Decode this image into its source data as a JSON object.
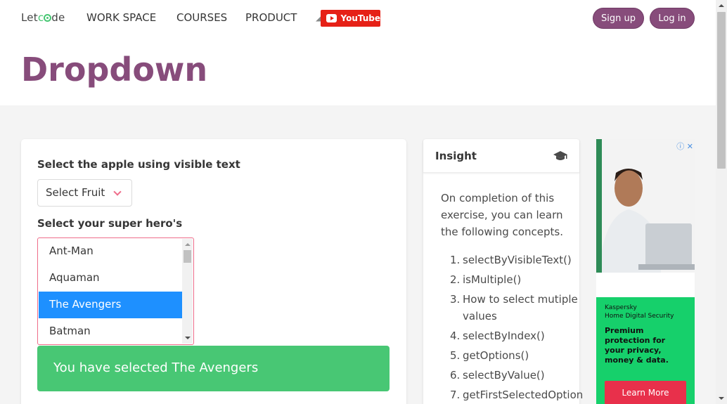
{
  "nav": {
    "logo_left": "Let",
    "logo_right": "de",
    "items": [
      "WORK SPACE",
      "COURSES",
      "PRODUCT"
    ],
    "youtube": "YouTube",
    "signup": "Sign up",
    "login": "Log in"
  },
  "hero": {
    "title": "Dropdown"
  },
  "main": {
    "fruit_label": "Select the apple using visible text",
    "fruit_select": "Select Fruit",
    "hero_label": "Select your super hero's",
    "heroes": [
      "Ant-Man",
      "Aquaman",
      "The Avengers",
      "Batman"
    ],
    "selected_index": 2,
    "notice": "You have selected The Avengers"
  },
  "insight": {
    "title": "Insight",
    "icon": "graduation-cap-icon",
    "intro": "On completion of this exercise, you can learn the following concepts.",
    "concepts": [
      "selectByVisibleText()",
      "isMultiple()",
      "How to select mutiple values",
      "selectByIndex()",
      "getOptions()",
      "selectByValue()",
      "getFirstSelectedOption"
    ]
  },
  "ad": {
    "brand": "Kaspersky\nHome Digital Security",
    "headline": "Premium protection for your privacy, money & data.",
    "cta": "Learn More"
  },
  "colors": {
    "brand_purple": "#874c7b",
    "success_green": "#48c774",
    "select_blue": "#1e90ff",
    "youtube_red": "#e62117"
  }
}
